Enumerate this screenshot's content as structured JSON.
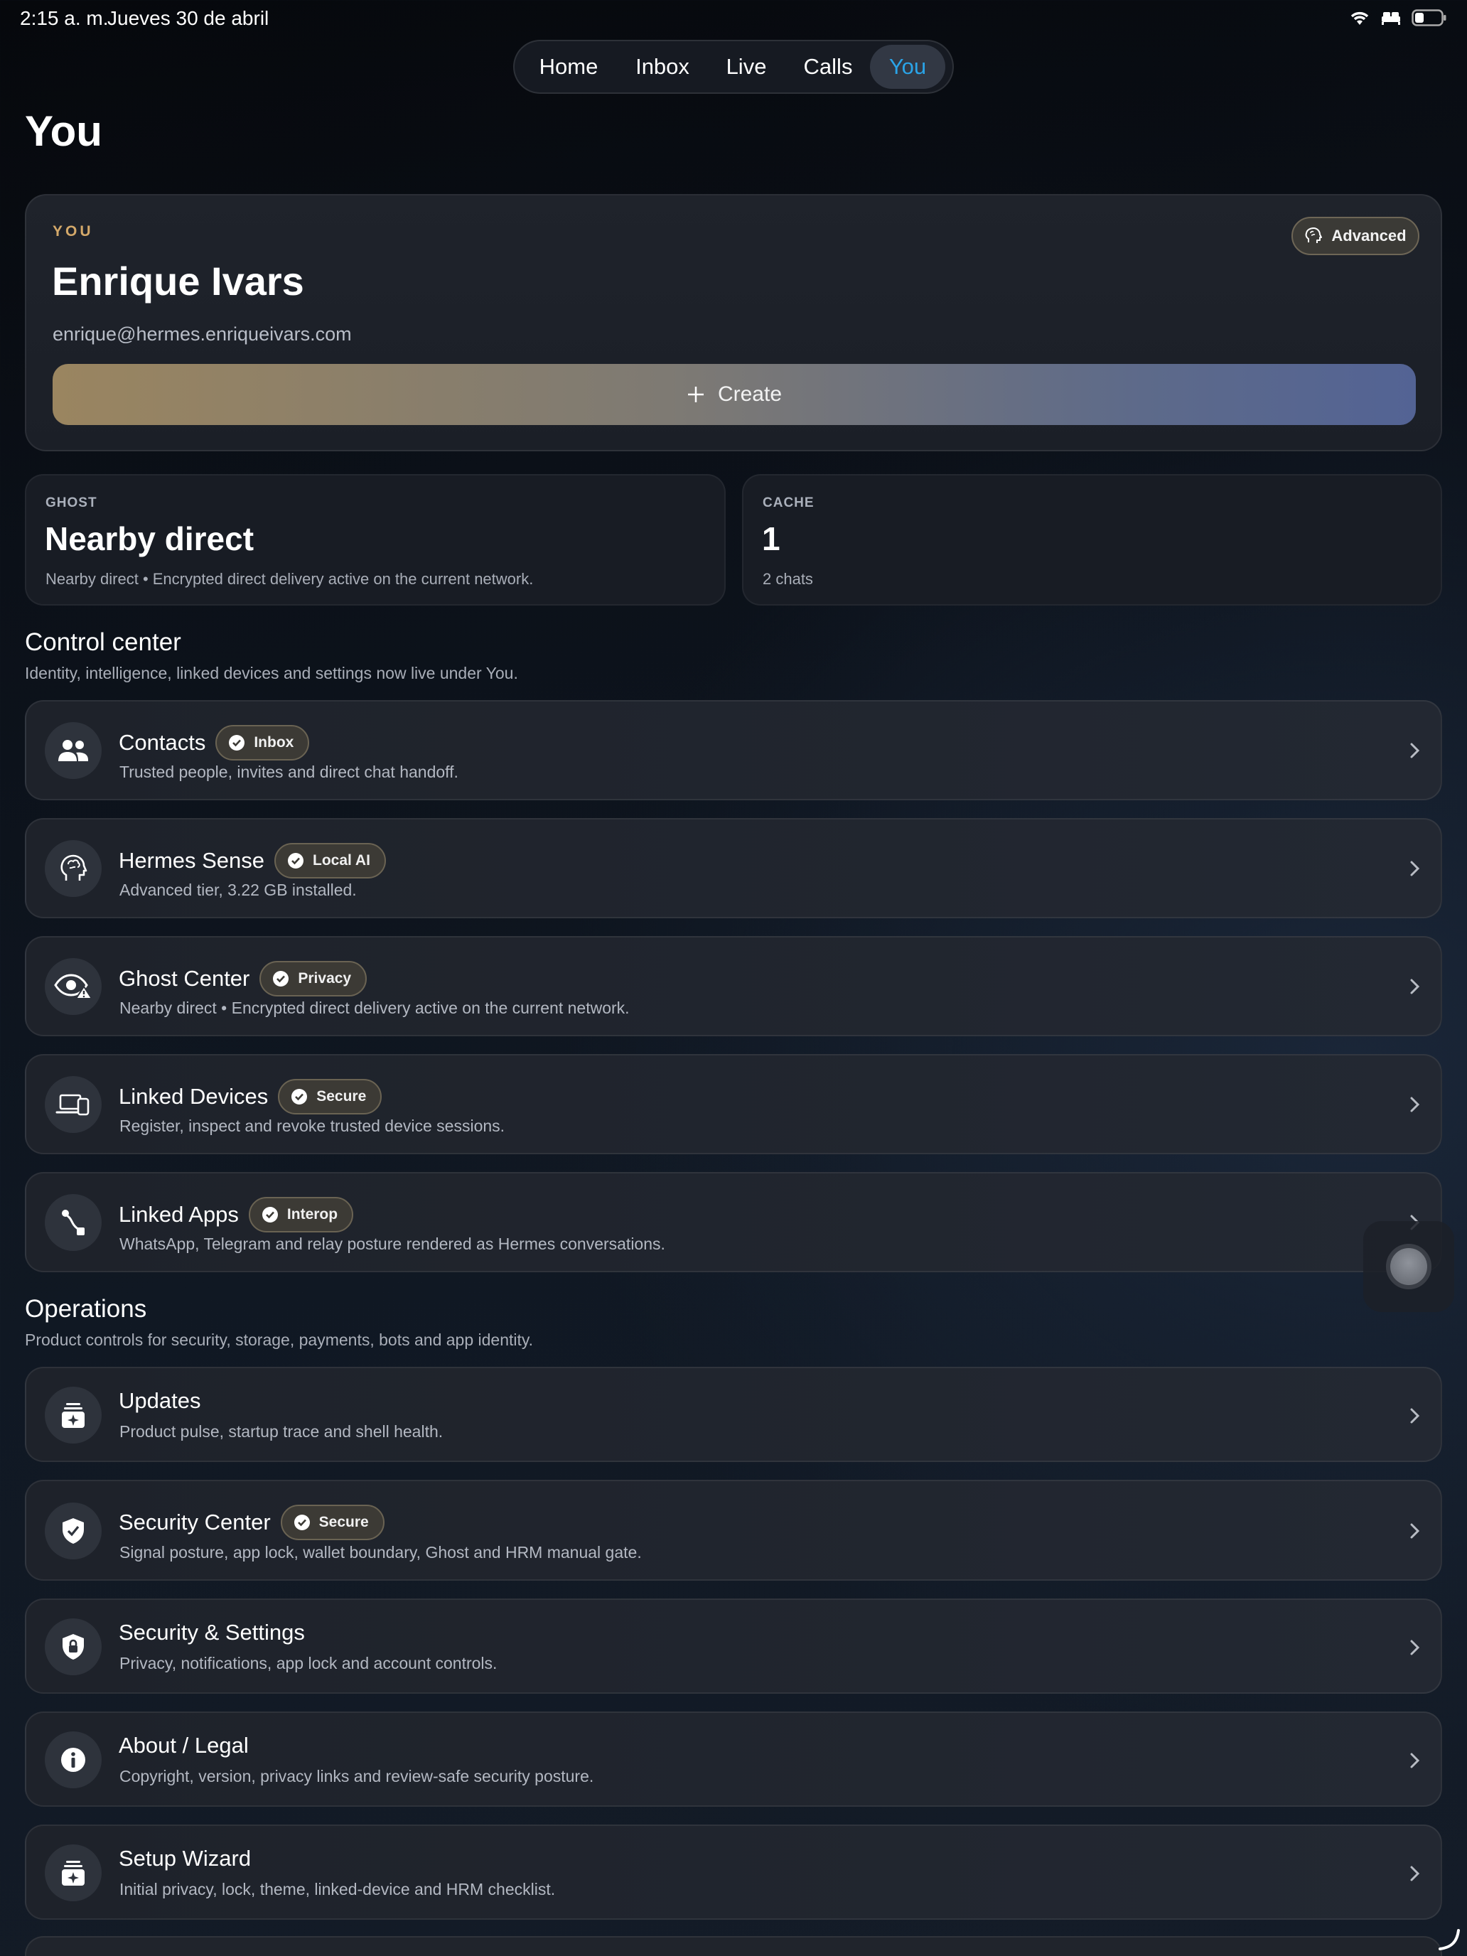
{
  "status_bar": {
    "time": "2:15 a. m.",
    "date": "Jueves 30 de abril"
  },
  "tabs": [
    {
      "label": "Home",
      "active": false
    },
    {
      "label": "Inbox",
      "active": false
    },
    {
      "label": "Live",
      "active": false
    },
    {
      "label": "Calls",
      "active": false
    },
    {
      "label": "You",
      "active": true
    }
  ],
  "page_title": "You",
  "profile": {
    "kicker": "YOU",
    "name": "Enrique Ivars",
    "email": "enrique@hermes.enriqueivars.com",
    "tier_badge": "Advanced",
    "create_label": "Create"
  },
  "stats": {
    "ghost": {
      "label": "GHOST",
      "value": "Nearby direct",
      "sub": "Nearby direct • Encrypted direct delivery active on the current network."
    },
    "cache": {
      "label": "CACHE",
      "value": "1",
      "sub": "2 chats"
    }
  },
  "control_center": {
    "title": "Control center",
    "subtitle": "Identity, intelligence, linked devices and settings now live under You.",
    "items": [
      {
        "title": "Contacts",
        "badge": "Inbox",
        "desc": "Trusted people, invites and direct chat handoff.",
        "icon": "people-icon"
      },
      {
        "title": "Hermes Sense",
        "badge": "Local AI",
        "desc": "Advanced tier, 3.22 GB installed.",
        "icon": "brain-head-icon"
      },
      {
        "title": "Ghost Center",
        "badge": "Privacy",
        "desc": "Nearby direct • Encrypted direct delivery active on the current network.",
        "icon": "eye-warning-icon"
      },
      {
        "title": "Linked Devices",
        "badge": "Secure",
        "desc": "Register, inspect and revoke trusted device sessions.",
        "icon": "laptop-phone-icon"
      },
      {
        "title": "Linked Apps",
        "badge": "Interop",
        "desc": "WhatsApp, Telegram and relay posture rendered as Hermes conversations.",
        "icon": "route-icon"
      }
    ]
  },
  "operations": {
    "title": "Operations",
    "subtitle": "Product controls for security, storage, payments, bots and app identity.",
    "items": [
      {
        "title": "Updates",
        "badge": "",
        "desc": "Product pulse, startup trace and shell health.",
        "icon": "sparkle-box-icon"
      },
      {
        "title": "Security Center",
        "badge": "Secure",
        "desc": "Signal posture, app lock, wallet boundary, Ghost and HRM manual gate.",
        "icon": "shield-check-icon"
      },
      {
        "title": "Security & Settings",
        "badge": "",
        "desc": "Privacy, notifications, app lock and account controls.",
        "icon": "shield-lock-icon"
      },
      {
        "title": "About / Legal",
        "badge": "",
        "desc": "Copyright, version, privacy links and review-safe security posture.",
        "icon": "info-icon"
      },
      {
        "title": "Setup Wizard",
        "badge": "",
        "desc": "Initial privacy, lock, theme, linked-device and HRM checklist.",
        "icon": "sparkle-box-icon"
      }
    ]
  },
  "colors": {
    "accent_tab": "#2aa4e8",
    "kicker": "#d4a96a"
  }
}
